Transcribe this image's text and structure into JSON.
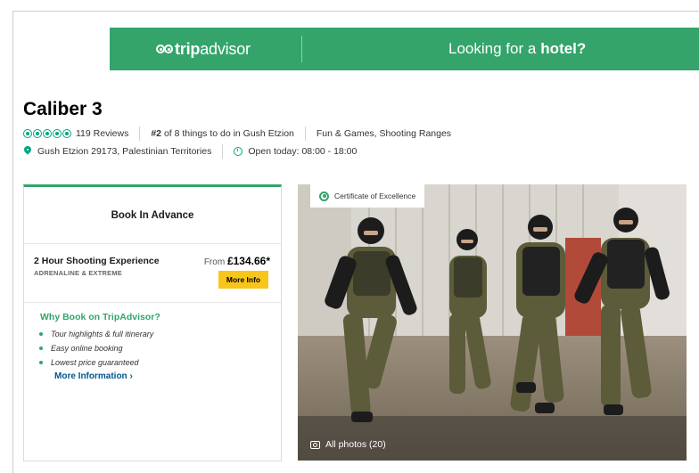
{
  "banner": {
    "logo_prefix": "trip",
    "logo_suffix": "advisor",
    "cta_text": "Looking for a",
    "cta_bold": "hotel?"
  },
  "attraction": {
    "name": "Caliber 3",
    "rating_bubbles": 5,
    "reviews": "119 Reviews",
    "rank_bold": "#2",
    "rank_text": "of 8 things to do in Gush Etzion",
    "categories": "Fun & Games, Shooting Ranges",
    "address": "Gush Etzion 29173, Palestinian Territories",
    "hours": "Open today: 08:00 - 18:00"
  },
  "booking": {
    "heading": "Book In Advance",
    "offer": {
      "name": "2 Hour Shooting Experience",
      "category": "ADRENALINE & EXTREME",
      "price_prefix": "From",
      "price": "£134.66*",
      "button": "More Info"
    },
    "why": {
      "question": "Why Book on TripAdvisor?",
      "benefits": [
        "Tour highlights & full itinerary",
        "Easy online booking",
        "Lowest price guaranteed"
      ],
      "more_link": "More Information ›"
    }
  },
  "photo": {
    "certificate": "Certificate of Excellence",
    "all_photos": "All photos (20)"
  },
  "colors": {
    "brand_green": "#34a46b",
    "bubble_green": "#00a680",
    "button_yellow": "#f8c61a",
    "link_blue": "#00558a"
  }
}
